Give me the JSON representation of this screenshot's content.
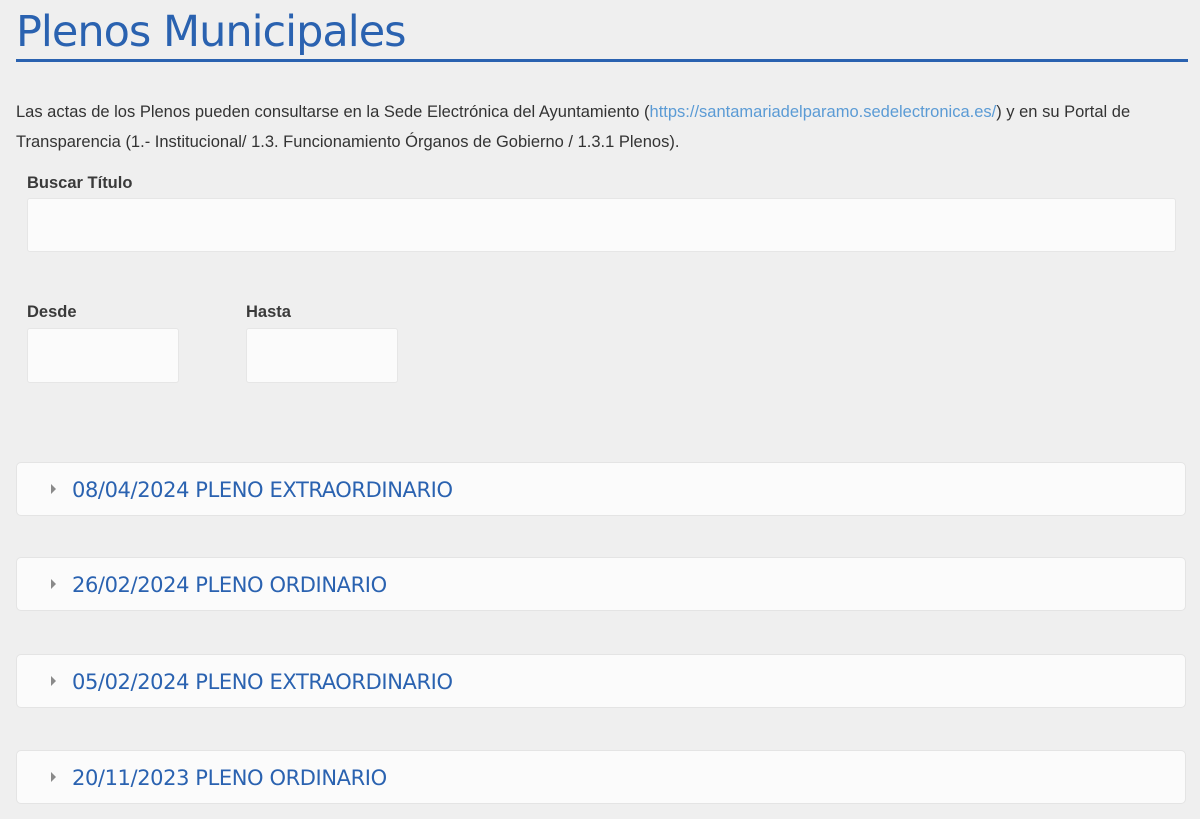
{
  "page": {
    "title": "Plenos Municipales"
  },
  "intro": {
    "text_before": "Las actas de los Plenos pueden consultarse en la Sede Electrónica del Ayuntamiento (",
    "link_text": "https://santamariadelparamo.sedelectronica.es/",
    "text_after": ") y en su Portal de Transparencia (1.- Institucional/ 1.3. Funcionamiento Órganos de Gobierno / 1.3.1 Plenos)."
  },
  "filters": {
    "search_label": "Buscar Título",
    "search_value": "",
    "from_label": "Desde",
    "from_value": "",
    "to_label": "Hasta",
    "to_value": ""
  },
  "plenos": [
    {
      "title": "08/04/2024 PLENO EXTRAORDINARIO"
    },
    {
      "title": "26/02/2024 PLENO ORDINARIO"
    },
    {
      "title": "05/02/2024 PLENO EXTRAORDINARIO"
    },
    {
      "title": "20/11/2023 PLENO ORDINARIO"
    }
  ],
  "colors": {
    "accent": "#2a62b0",
    "link": "#5b9bd5",
    "background": "#efefef",
    "text": "#333333"
  }
}
